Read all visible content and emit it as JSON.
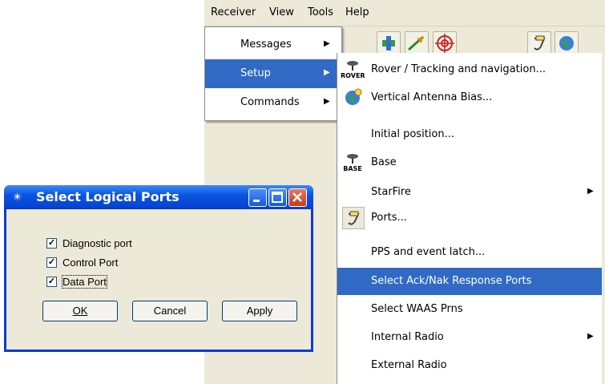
{
  "menubar": {
    "items": [
      "Receiver",
      "View",
      "Tools",
      "Help"
    ]
  },
  "submenu1": {
    "items": [
      {
        "label": "Messages",
        "has_submenu": true,
        "highlighted": false
      },
      {
        "label": "Setup",
        "has_submenu": true,
        "highlighted": true
      },
      {
        "label": "Commands",
        "has_submenu": true,
        "highlighted": false
      }
    ]
  },
  "submenu2": {
    "items": [
      {
        "label": "Rover / Tracking and navigation...",
        "icon": "rover-icon",
        "icon_text": "ROVER"
      },
      {
        "label": "Vertical Antenna Bias...",
        "icon": "antenna-globe-icon"
      },
      {
        "label": "Initial position...",
        "icon": ""
      },
      {
        "label": "Base",
        "icon": "base-icon",
        "icon_text": "BASE"
      },
      {
        "label": "StarFire",
        "icon": "",
        "has_submenu": true
      },
      {
        "label": "Ports...",
        "icon": "ports-icon"
      },
      {
        "label": "PPS and event latch...",
        "icon": ""
      },
      {
        "label": "Select Ack/Nak Response Ports",
        "icon": "",
        "highlighted": true
      },
      {
        "label": "Select WAAS Prns",
        "icon": ""
      },
      {
        "label": "Internal Radio",
        "icon": "",
        "has_submenu": true
      },
      {
        "label": "External Radio",
        "icon": ""
      }
    ]
  },
  "dialog": {
    "title": "Select Logical Ports",
    "checks": [
      {
        "label": "Diagnostic port",
        "checked": true
      },
      {
        "label": "Control Port",
        "checked": true
      },
      {
        "label": "Data Port",
        "checked": true
      }
    ],
    "buttons": {
      "ok": "OK",
      "cancel": "Cancel",
      "apply": "Apply"
    }
  },
  "colors": {
    "highlight": "#316ac5",
    "titlebar": "#0a55e3",
    "dialog_bg": "#ece9d8"
  }
}
